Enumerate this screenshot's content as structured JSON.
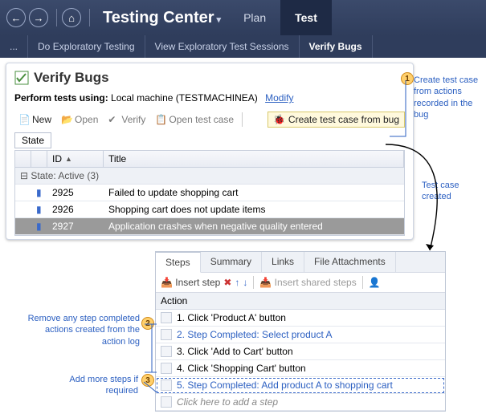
{
  "topbar": {
    "title": "Testing Center",
    "tabs": [
      {
        "label": "Plan",
        "active": false
      },
      {
        "label": "Test",
        "active": true
      }
    ]
  },
  "subnav": {
    "ellipsis": "...",
    "items": [
      {
        "label": "Do Exploratory Testing",
        "active": false
      },
      {
        "label": "View Exploratory Test Sessions",
        "active": false
      },
      {
        "label": "Verify Bugs",
        "active": true
      }
    ]
  },
  "pane": {
    "title": "Verify Bugs",
    "perform_label": "Perform tests using:",
    "perform_value": "Local machine (TESTMACHINEA)",
    "modify": "Modify",
    "toolbar": {
      "new": "New",
      "open": "Open",
      "verify": "Verify",
      "open_test_case": "Open test case",
      "create_from_bug": "Create test case from bug"
    },
    "state_btn": "State",
    "columns": {
      "id": "ID",
      "title": "Title"
    },
    "group_label": "State: Active (3)",
    "rows": [
      {
        "id": "2925",
        "title": "Failed to update shopping cart",
        "selected": false
      },
      {
        "id": "2926",
        "title": "Shopping cart does not update items",
        "selected": false
      },
      {
        "id": "2927",
        "title": "Application crashes when negative quality entered",
        "selected": true
      }
    ]
  },
  "steps": {
    "tabs": [
      {
        "label": "Steps",
        "active": true
      },
      {
        "label": "Summary",
        "active": false
      },
      {
        "label": "Links",
        "active": false
      },
      {
        "label": "File Attachments",
        "active": false
      }
    ],
    "toolbar": {
      "insert_step": "Insert step",
      "insert_shared": "Insert shared steps"
    },
    "action_header": "Action",
    "rows": [
      {
        "text": "1. Click 'Product A' button",
        "completed": false
      },
      {
        "text": "2. Step Completed: Select product A",
        "completed": true
      },
      {
        "text": "3. Click 'Add to Cart' button",
        "completed": false
      },
      {
        "text": "4. Click 'Shopping Cart' button",
        "completed": false
      },
      {
        "text": "5. Step Completed: Add product A to shopping cart",
        "completed": true
      }
    ],
    "add_placeholder": "Click here to add a step"
  },
  "annotations": {
    "a1": "Create test case from actions recorded in the bug",
    "a2": "Test case created",
    "a3": "Remove any step completed actions created from the action log",
    "a4": "Add more steps if required"
  }
}
